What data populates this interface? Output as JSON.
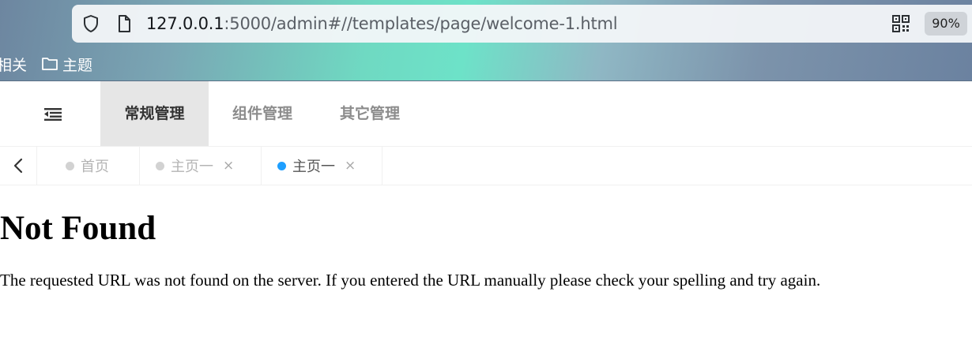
{
  "browser": {
    "url_host": "127.0.0.1",
    "url_rest": ":5000/admin#//templates/page/welcome-1.html",
    "zoom": "90%",
    "bookmarks": [
      {
        "label": "相关"
      },
      {
        "label": "主题",
        "icon": "folder-icon"
      }
    ]
  },
  "header": {
    "menu_toggle_icon": "menu-fold-icon",
    "nav_tabs": [
      {
        "label": "常规管理",
        "active": true
      },
      {
        "label": "组件管理",
        "active": false
      },
      {
        "label": "其它管理",
        "active": false
      }
    ]
  },
  "tabs": {
    "prev_icon": "chevron-left-icon",
    "items": [
      {
        "label": "首页",
        "closable": false,
        "active": false
      },
      {
        "label": "主页一",
        "closable": true,
        "active": false,
        "close": "×"
      },
      {
        "label": "主页一",
        "closable": true,
        "active": true,
        "close": "×"
      }
    ]
  },
  "content": {
    "title": "Not Found",
    "message": "The requested URL was not found on the server. If you entered the URL manually please check your spelling and try again."
  },
  "colors": {
    "active_tab_dot": "#1e9fff",
    "inactive_tab_dot": "#d2d2d2",
    "active_nav_bg": "#e6e6e6"
  }
}
